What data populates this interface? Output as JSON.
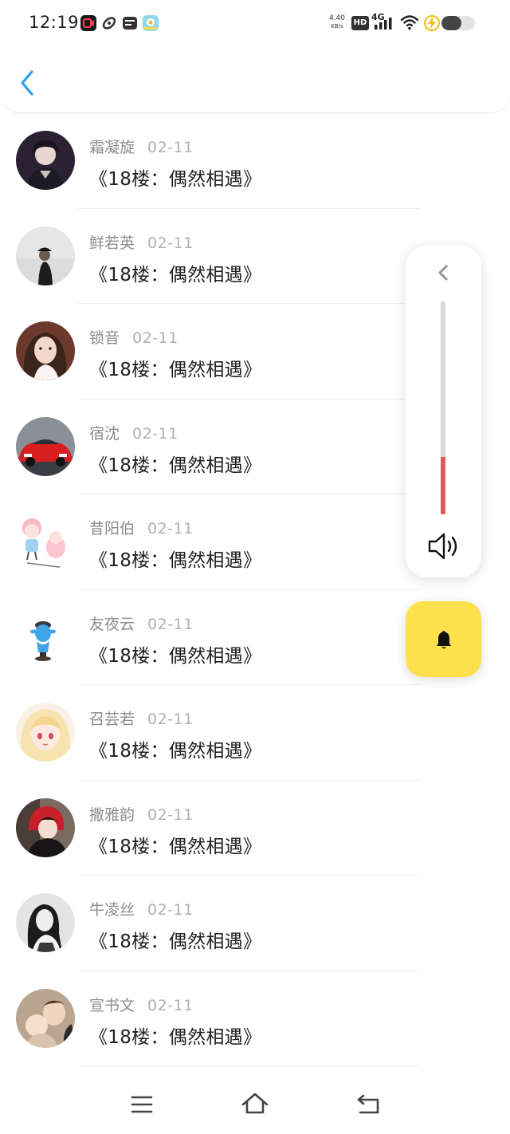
{
  "status_bar": {
    "time": "12:19",
    "net_speed_value": "4.40",
    "net_speed_unit": "KB/s",
    "hd_badge": "HD",
    "network_type": "4G",
    "battery_level": 0.6,
    "icons": [
      "video-app-icon",
      "link-app-icon",
      "card-app-icon",
      "map-app-icon",
      "signal-icon",
      "wifi-icon",
      "charging-icon",
      "battery-icon"
    ]
  },
  "header": {
    "back_icon": "chevron-left-icon",
    "accent": "#2e9ef0"
  },
  "list": {
    "items": [
      {
        "name": "霜凝旋",
        "date": "02-11",
        "title": "《18楼：偶然相遇》"
      },
      {
        "name": "鲜若英",
        "date": "02-11",
        "title": "《18楼：偶然相遇》"
      },
      {
        "name": "锁音",
        "date": "02-11",
        "title": "《18楼：偶然相遇》"
      },
      {
        "name": "宿沈",
        "date": "02-11",
        "title": "《18楼：偶然相遇》"
      },
      {
        "name": "昔阳伯",
        "date": "02-11",
        "title": "《18楼：偶然相遇》"
      },
      {
        "name": "友夜云",
        "date": "02-11",
        "title": "《18楼：偶然相遇》"
      },
      {
        "name": "召芸若",
        "date": "02-11",
        "title": "《18楼：偶然相遇》"
      },
      {
        "name": "撒雅韵",
        "date": "02-11",
        "title": "《18楼：偶然相遇》"
      },
      {
        "name": "牛凌丝",
        "date": "02-11",
        "title": "《18楼：偶然相遇》"
      },
      {
        "name": "宣书文",
        "date": "02-11",
        "title": "《18楼：偶然相遇》"
      }
    ]
  },
  "volume_panel": {
    "level": 0.27,
    "fill_color": "#e05c63",
    "icons": [
      "chevron-left-icon",
      "speaker-icon"
    ]
  },
  "bell_button": {
    "icon": "bell-icon",
    "color": "#fde04c"
  },
  "nav_bar": {
    "icons": [
      "menu-icon",
      "home-icon",
      "back-icon"
    ]
  }
}
